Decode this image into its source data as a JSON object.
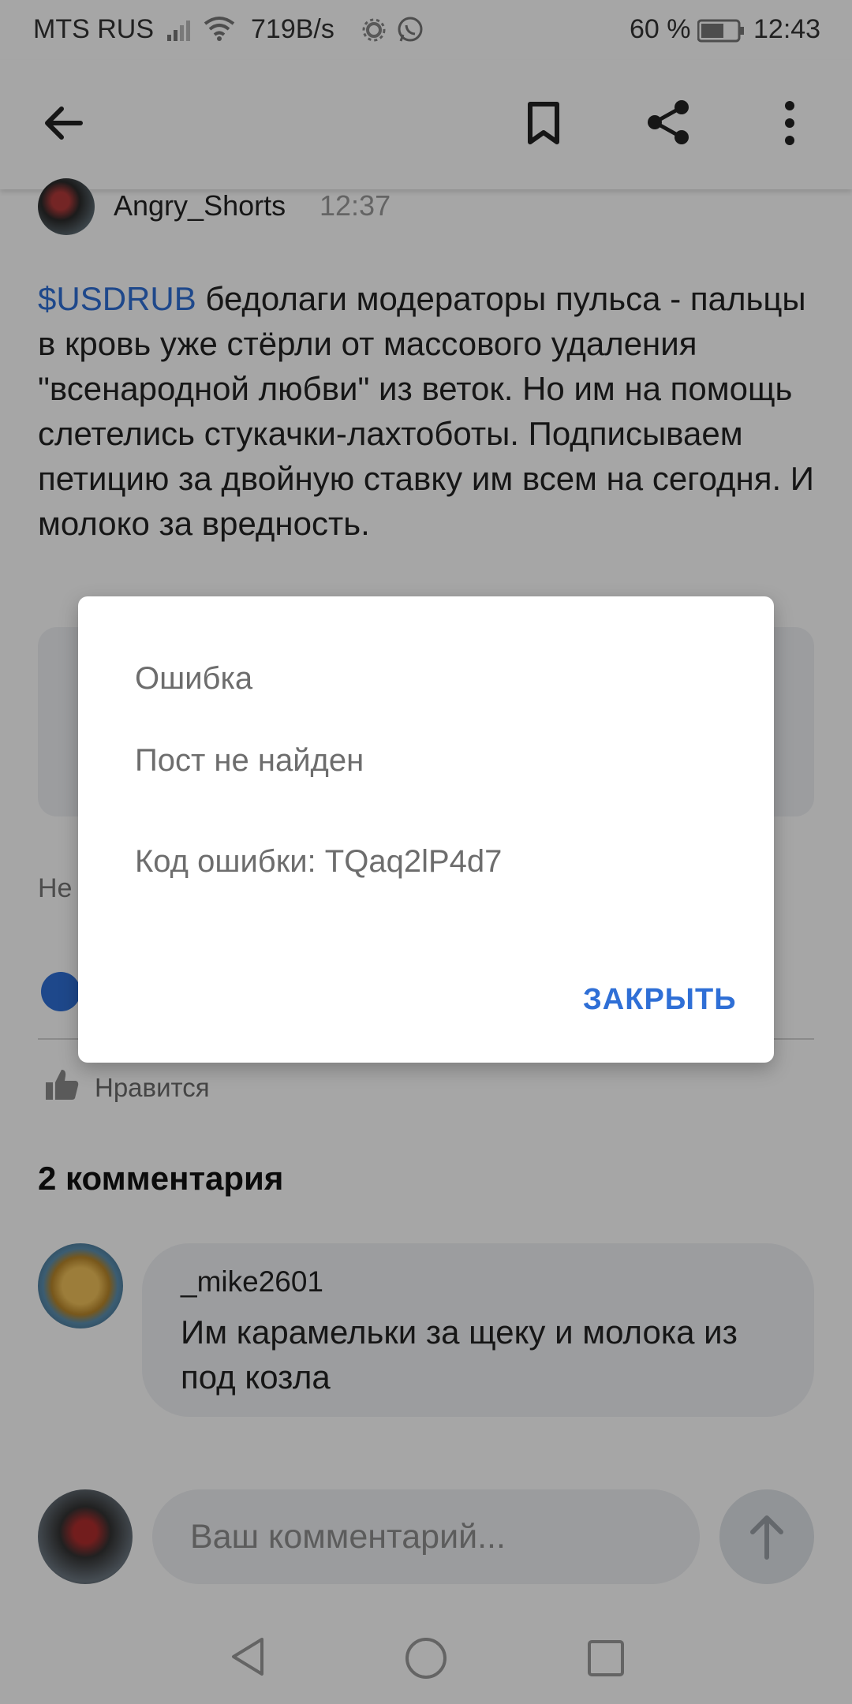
{
  "status_bar": {
    "carrier": "MTS RUS",
    "net_speed": "719B/s",
    "battery_percent": "60 %",
    "time": "12:43",
    "icons": [
      "signal-icon",
      "wifi-icon",
      "settings-cog-icon",
      "whatsapp-icon",
      "battery-icon"
    ]
  },
  "app_bar": {
    "back_icon": "arrow-left-icon",
    "bookmark_icon": "bookmark-icon",
    "share_icon": "share-icon",
    "more_icon": "more-vertical-icon"
  },
  "post": {
    "author": "Angry_Shorts",
    "time": "12:37",
    "ticker": "$USDRUB",
    "text": " бедолаги модераторы пульса - пальцы в кровь уже стёрли от массового удаления \"всенародной любви\" из веток. Но им на помощь слетелись стукачки-лахтоботы. Подписываем петицию за двойную ставку им всем на сегодня. И молоко за вредность.",
    "blurb_partial": "Не рек",
    "like_label": "Нравится"
  },
  "comments": {
    "title": "2 комментария",
    "items": [
      {
        "author": "_mike2601",
        "text": "Им карамельки за щеку и молока из под козла"
      }
    ]
  },
  "composer": {
    "placeholder": "Ваш комментарий..."
  },
  "dialog": {
    "title": "Ошибка",
    "message": "Пост не найден",
    "code_label": "Код ошибки: ",
    "code_value": "TQaq2lP4d7",
    "close_label": "ЗАКРЫТЬ"
  },
  "colors": {
    "accent": "#2f6fd6",
    "scrim": "rgba(0,0,0,0.35)"
  }
}
